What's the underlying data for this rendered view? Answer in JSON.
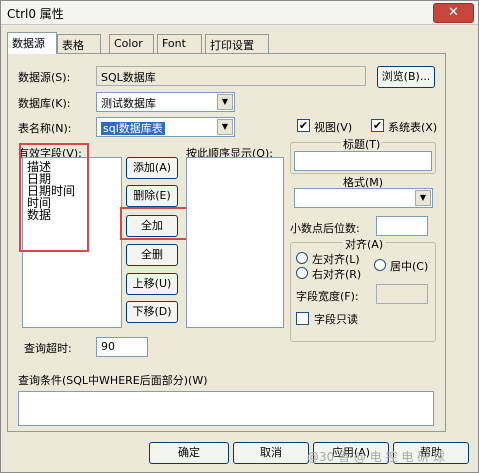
{
  "window": {
    "title": "Ctrl0 属性",
    "close_label": "✕"
  },
  "tabs": [
    {
      "label": "数据源"
    },
    {
      "label": "表格"
    },
    {
      "label": "Color"
    },
    {
      "label": "Font"
    },
    {
      "label": "打印设置"
    }
  ],
  "datasource": {
    "label": "数据源(S):",
    "value": "SQL数据库",
    "browse_label": "浏览(B)..."
  },
  "database": {
    "label": "数据库(K):",
    "value": "测试数据库"
  },
  "table_name": {
    "label": "表名称(N):",
    "value": "sql数据库表"
  },
  "checks": {
    "view_label": "视图(V)",
    "system_label": "系统表(X)",
    "check_mark": "✔"
  },
  "fields": {
    "label": "有效字段(V):",
    "items": [
      "描述",
      "日期",
      "日期时间",
      "时间",
      "数据"
    ]
  },
  "order_display": {
    "label": "按此顺序显示(O):"
  },
  "buttons": {
    "add": "添加(A)",
    "delete": "删除(E)",
    "add_all": "全加",
    "delete_all": "全删",
    "move_up": "上移(U)",
    "move_down": "下移(D)"
  },
  "title_group": {
    "label": "标题(T)"
  },
  "format_group": {
    "label": "格式(M)",
    "decimal_label": "小数点后位数:"
  },
  "align_group": {
    "label": "对齐(A)",
    "left": "左对齐(L)",
    "right": "右对齐(R)",
    "center": "居中(C)",
    "width_label": "字段宽度(F):",
    "readonly_label": "字段只读"
  },
  "timeout": {
    "label": "查询超时:",
    "value": "90"
  },
  "query": {
    "label": "查询条件(SQL中WHERE后面部分)(W)",
    "value": ""
  },
  "footer": {
    "ok": "确定",
    "cancel": "取消",
    "apply": "应用(A)",
    "help": "帮助",
    "watermark": "@30  香  @ 电 控 电 研 球"
  }
}
